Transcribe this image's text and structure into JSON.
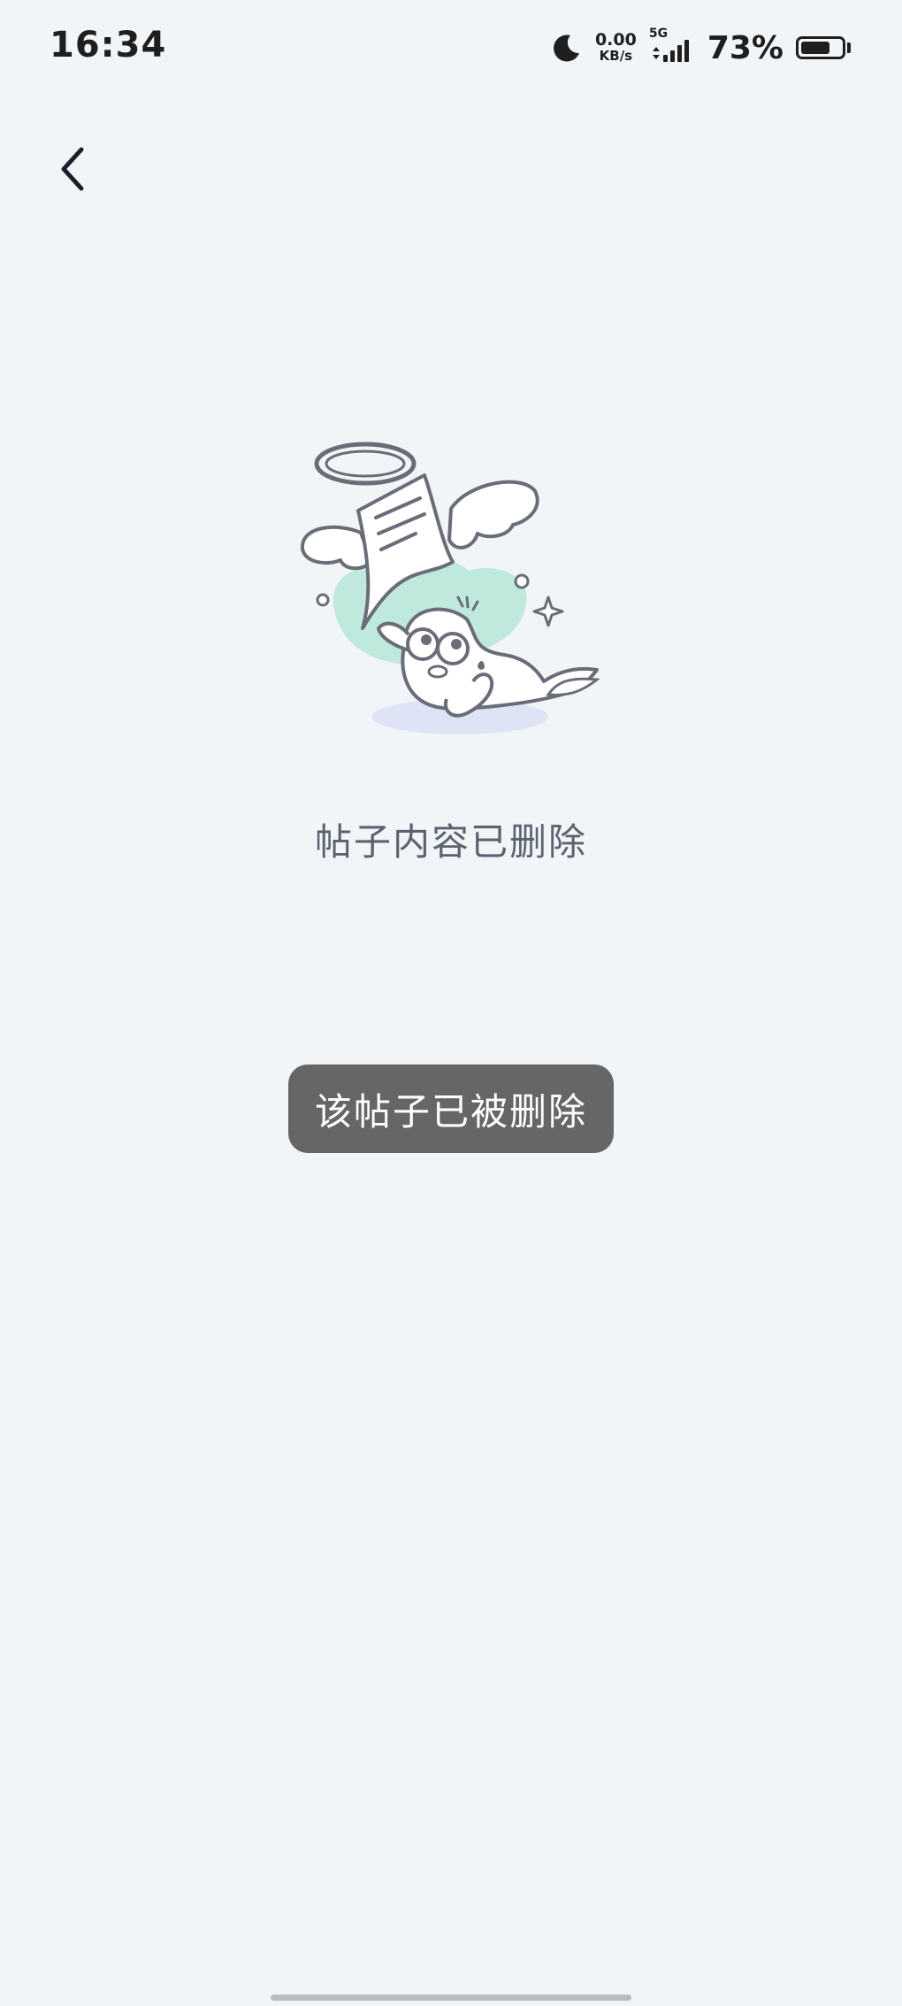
{
  "status_bar": {
    "time": "16:34",
    "net_speed_value": "0.00",
    "net_speed_unit": "KB/s",
    "network_type": "5G",
    "battery_percent": "73%",
    "battery_level": 0.73,
    "icons": [
      "moon-icon",
      "signal-icon",
      "battery-icon"
    ]
  },
  "nav": {
    "back_icon": "chevron-left-icon"
  },
  "empty_state": {
    "illustration": "deleted-post-illustration",
    "message": "帖子内容已删除"
  },
  "toast": {
    "message": "该帖子已被删除"
  },
  "colors": {
    "background": "#f2f5f8",
    "toast_background": "#666666",
    "accent_mint": "#bfe9dc",
    "shadow_lavender": "#dfe3f6",
    "text_secondary": "#5b6270"
  }
}
